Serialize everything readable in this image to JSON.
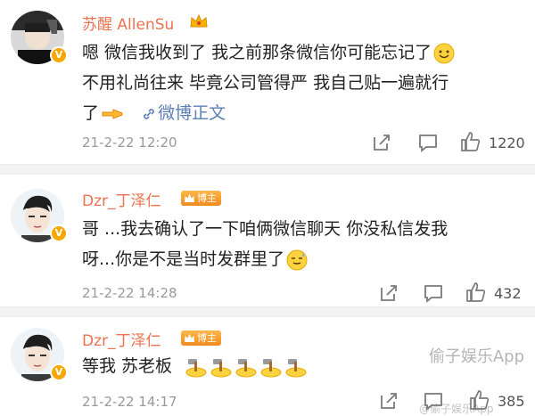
{
  "comments": [
    {
      "username": "苏醒 AllenSu",
      "text_lines": [
        "嗯 微信我收到了 我之前那条微信你可能忘记了",
        "不用礼尚往来 毕竟公司管得严 我自己贴一遍就行",
        "了"
      ],
      "link_label": "微博正文",
      "date": "21-2-22 12:20",
      "likes": "1220"
    },
    {
      "username": "Dzr_丁泽仁",
      "badge": "博主",
      "text_lines": [
        "哥 ...我去确认了一下咱俩微信聊天 你没私信发我",
        "呀...你是不是当时发群里了"
      ],
      "date": "21-2-22 14:28",
      "likes": "432"
    },
    {
      "username": "Dzr_丁泽仁",
      "badge": "博主",
      "text_lines": [
        "等我 苏老板"
      ],
      "date": "21-2-22 14:17",
      "likes": "385"
    }
  ],
  "watermark": "偷子娱乐App",
  "watermark_small": "@偷子娱乐App",
  "icons": {
    "verified": "verified-badge-icon",
    "share": "share-icon",
    "comment": "comment-icon",
    "like": "thumbs-up-icon",
    "crown": "crown-icon",
    "link": "weibo-link-icon",
    "smile": "smile-emoji",
    "pointing": "pointing-hand-emoji",
    "sweat": "sweat-smile-emoji",
    "hammer": "hammer-emoji"
  },
  "colors": {
    "username": "#eb7350",
    "link": "#5b7fb5",
    "verified": "#f7a700",
    "muted": "#9a9a9a"
  }
}
